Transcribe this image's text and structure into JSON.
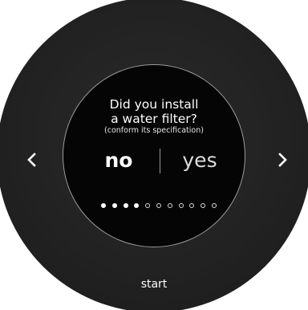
{
  "prompt": {
    "line1": "Did you install",
    "line2": "a water filter?",
    "hint": "(conform its specification)"
  },
  "choices": {
    "no_label": "no",
    "yes_label": "yes",
    "selected": "no"
  },
  "progress": {
    "current_step": 4,
    "total_steps": 11
  },
  "navigation": {
    "previous_icon": "chevron-left-icon",
    "next_icon": "chevron-right-icon",
    "start_label": "start"
  },
  "colors": {
    "dial_body": "#222222",
    "screen": "#050505",
    "screen_ring": "#9a9a9a",
    "text": "#ffffff"
  }
}
